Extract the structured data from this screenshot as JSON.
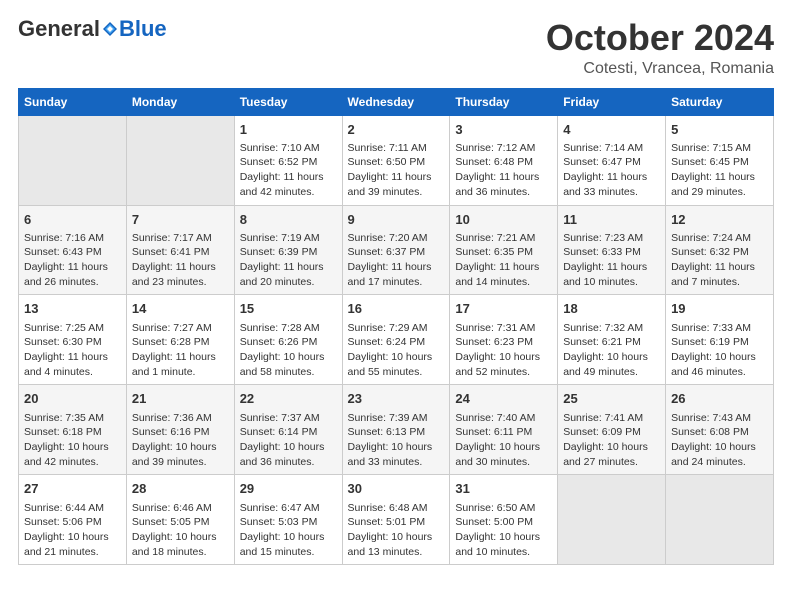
{
  "logo": {
    "general": "General",
    "blue": "Blue"
  },
  "title": "October 2024",
  "subtitle": "Cotesti, Vrancea, Romania",
  "days_of_week": [
    "Sunday",
    "Monday",
    "Tuesday",
    "Wednesday",
    "Thursday",
    "Friday",
    "Saturday"
  ],
  "weeks": [
    [
      {
        "day": "",
        "content": ""
      },
      {
        "day": "",
        "content": ""
      },
      {
        "day": "1",
        "content": "Sunrise: 7:10 AM\nSunset: 6:52 PM\nDaylight: 11 hours and 42 minutes."
      },
      {
        "day": "2",
        "content": "Sunrise: 7:11 AM\nSunset: 6:50 PM\nDaylight: 11 hours and 39 minutes."
      },
      {
        "day": "3",
        "content": "Sunrise: 7:12 AM\nSunset: 6:48 PM\nDaylight: 11 hours and 36 minutes."
      },
      {
        "day": "4",
        "content": "Sunrise: 7:14 AM\nSunset: 6:47 PM\nDaylight: 11 hours and 33 minutes."
      },
      {
        "day": "5",
        "content": "Sunrise: 7:15 AM\nSunset: 6:45 PM\nDaylight: 11 hours and 29 minutes."
      }
    ],
    [
      {
        "day": "6",
        "content": "Sunrise: 7:16 AM\nSunset: 6:43 PM\nDaylight: 11 hours and 26 minutes."
      },
      {
        "day": "7",
        "content": "Sunrise: 7:17 AM\nSunset: 6:41 PM\nDaylight: 11 hours and 23 minutes."
      },
      {
        "day": "8",
        "content": "Sunrise: 7:19 AM\nSunset: 6:39 PM\nDaylight: 11 hours and 20 minutes."
      },
      {
        "day": "9",
        "content": "Sunrise: 7:20 AM\nSunset: 6:37 PM\nDaylight: 11 hours and 17 minutes."
      },
      {
        "day": "10",
        "content": "Sunrise: 7:21 AM\nSunset: 6:35 PM\nDaylight: 11 hours and 14 minutes."
      },
      {
        "day": "11",
        "content": "Sunrise: 7:23 AM\nSunset: 6:33 PM\nDaylight: 11 hours and 10 minutes."
      },
      {
        "day": "12",
        "content": "Sunrise: 7:24 AM\nSunset: 6:32 PM\nDaylight: 11 hours and 7 minutes."
      }
    ],
    [
      {
        "day": "13",
        "content": "Sunrise: 7:25 AM\nSunset: 6:30 PM\nDaylight: 11 hours and 4 minutes."
      },
      {
        "day": "14",
        "content": "Sunrise: 7:27 AM\nSunset: 6:28 PM\nDaylight: 11 hours and 1 minute."
      },
      {
        "day": "15",
        "content": "Sunrise: 7:28 AM\nSunset: 6:26 PM\nDaylight: 10 hours and 58 minutes."
      },
      {
        "day": "16",
        "content": "Sunrise: 7:29 AM\nSunset: 6:24 PM\nDaylight: 10 hours and 55 minutes."
      },
      {
        "day": "17",
        "content": "Sunrise: 7:31 AM\nSunset: 6:23 PM\nDaylight: 10 hours and 52 minutes."
      },
      {
        "day": "18",
        "content": "Sunrise: 7:32 AM\nSunset: 6:21 PM\nDaylight: 10 hours and 49 minutes."
      },
      {
        "day": "19",
        "content": "Sunrise: 7:33 AM\nSunset: 6:19 PM\nDaylight: 10 hours and 46 minutes."
      }
    ],
    [
      {
        "day": "20",
        "content": "Sunrise: 7:35 AM\nSunset: 6:18 PM\nDaylight: 10 hours and 42 minutes."
      },
      {
        "day": "21",
        "content": "Sunrise: 7:36 AM\nSunset: 6:16 PM\nDaylight: 10 hours and 39 minutes."
      },
      {
        "day": "22",
        "content": "Sunrise: 7:37 AM\nSunset: 6:14 PM\nDaylight: 10 hours and 36 minutes."
      },
      {
        "day": "23",
        "content": "Sunrise: 7:39 AM\nSunset: 6:13 PM\nDaylight: 10 hours and 33 minutes."
      },
      {
        "day": "24",
        "content": "Sunrise: 7:40 AM\nSunset: 6:11 PM\nDaylight: 10 hours and 30 minutes."
      },
      {
        "day": "25",
        "content": "Sunrise: 7:41 AM\nSunset: 6:09 PM\nDaylight: 10 hours and 27 minutes."
      },
      {
        "day": "26",
        "content": "Sunrise: 7:43 AM\nSunset: 6:08 PM\nDaylight: 10 hours and 24 minutes."
      }
    ],
    [
      {
        "day": "27",
        "content": "Sunrise: 6:44 AM\nSunset: 5:06 PM\nDaylight: 10 hours and 21 minutes."
      },
      {
        "day": "28",
        "content": "Sunrise: 6:46 AM\nSunset: 5:05 PM\nDaylight: 10 hours and 18 minutes."
      },
      {
        "day": "29",
        "content": "Sunrise: 6:47 AM\nSunset: 5:03 PM\nDaylight: 10 hours and 15 minutes."
      },
      {
        "day": "30",
        "content": "Sunrise: 6:48 AM\nSunset: 5:01 PM\nDaylight: 10 hours and 13 minutes."
      },
      {
        "day": "31",
        "content": "Sunrise: 6:50 AM\nSunset: 5:00 PM\nDaylight: 10 hours and 10 minutes."
      },
      {
        "day": "",
        "content": ""
      },
      {
        "day": "",
        "content": ""
      }
    ]
  ]
}
